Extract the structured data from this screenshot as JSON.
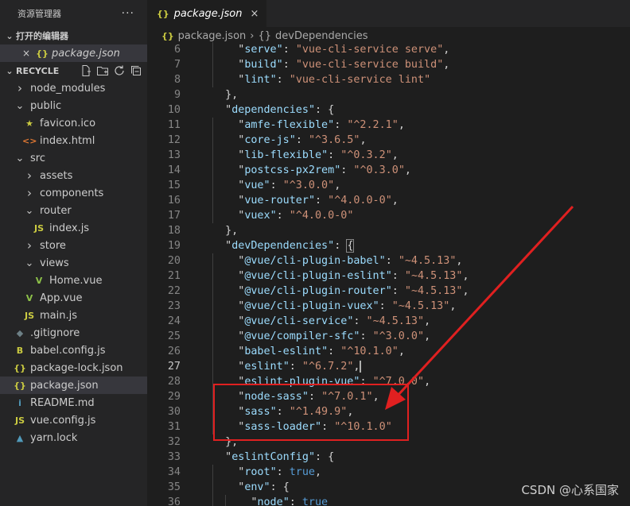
{
  "sidebar": {
    "title": "资源管理器",
    "more": "···",
    "open_editors_title": "打开的编辑器",
    "open_editor": {
      "close": "×",
      "icon": "{}",
      "name": "package.json"
    },
    "project_title": "RECYCLE",
    "tree": [
      {
        "label": "node_modules",
        "type": "folder",
        "expanded": false,
        "depth": 1
      },
      {
        "label": "public",
        "type": "folder",
        "expanded": true,
        "depth": 1
      },
      {
        "label": "favicon.ico",
        "type": "file",
        "icon": "★",
        "icon_color": "#cbcb41",
        "depth": 2
      },
      {
        "label": "index.html",
        "type": "file",
        "icon": "<>",
        "icon_color": "#e37933",
        "depth": 2
      },
      {
        "label": "src",
        "type": "folder",
        "expanded": true,
        "depth": 1
      },
      {
        "label": "assets",
        "type": "folder",
        "expanded": false,
        "depth": 2
      },
      {
        "label": "components",
        "type": "folder",
        "expanded": false,
        "depth": 2
      },
      {
        "label": "router",
        "type": "folder",
        "expanded": true,
        "depth": 2
      },
      {
        "label": "index.js",
        "type": "file",
        "icon": "JS",
        "icon_color": "#cbcb41",
        "depth": 3
      },
      {
        "label": "store",
        "type": "folder",
        "expanded": false,
        "depth": 2
      },
      {
        "label": "views",
        "type": "folder",
        "expanded": true,
        "depth": 2
      },
      {
        "label": "Home.vue",
        "type": "file",
        "icon": "V",
        "icon_color": "#8dc149",
        "depth": 3
      },
      {
        "label": "App.vue",
        "type": "file",
        "icon": "V",
        "icon_color": "#8dc149",
        "depth": 2
      },
      {
        "label": "main.js",
        "type": "file",
        "icon": "JS",
        "icon_color": "#cbcb41",
        "depth": 2
      },
      {
        "label": ".gitignore",
        "type": "file",
        "icon": "◆",
        "icon_color": "#6d8086",
        "depth": 1
      },
      {
        "label": "babel.config.js",
        "type": "file",
        "icon": "B",
        "icon_color": "#cbcb41",
        "depth": 1
      },
      {
        "label": "package-lock.json",
        "type": "file",
        "icon": "{}",
        "icon_color": "#cbcb41",
        "depth": 1
      },
      {
        "label": "package.json",
        "type": "file",
        "icon": "{}",
        "icon_color": "#cbcb41",
        "depth": 1,
        "selected": true
      },
      {
        "label": "README.md",
        "type": "file",
        "icon": "i",
        "icon_color": "#519aba",
        "depth": 1
      },
      {
        "label": "vue.config.js",
        "type": "file",
        "icon": "JS",
        "icon_color": "#cbcb41",
        "depth": 1
      },
      {
        "label": "yarn.lock",
        "type": "file",
        "icon": "▲",
        "icon_color": "#519aba",
        "depth": 1
      }
    ]
  },
  "editor": {
    "tab": {
      "icon": "{}",
      "label": "package.json",
      "close": "×"
    },
    "breadcrumb": {
      "file_icon": "{}",
      "file": "package.json",
      "separator": "›",
      "symbol_icon": "{}",
      "symbol": "devDependencies"
    },
    "current_line": 27,
    "lines": [
      {
        "n": 6,
        "indent": 2,
        "key": "serve",
        "value": "vue-cli-service serve",
        "comma": true
      },
      {
        "n": 7,
        "indent": 2,
        "key": "build",
        "value": "vue-cli-service build",
        "comma": true
      },
      {
        "n": 8,
        "indent": 2,
        "key": "lint",
        "value": "vue-cli-service lint",
        "comma": false
      },
      {
        "n": 9,
        "indent": 1,
        "raw": "},"
      },
      {
        "n": 10,
        "indent": 1,
        "key": "dependencies",
        "open": "{"
      },
      {
        "n": 11,
        "indent": 2,
        "key": "amfe-flexible",
        "value": "^2.2.1",
        "comma": true
      },
      {
        "n": 12,
        "indent": 2,
        "key": "core-js",
        "value": "^3.6.5",
        "comma": true
      },
      {
        "n": 13,
        "indent": 2,
        "key": "lib-flexible",
        "value": "^0.3.2",
        "comma": true
      },
      {
        "n": 14,
        "indent": 2,
        "key": "postcss-px2rem",
        "value": "^0.3.0",
        "comma": true
      },
      {
        "n": 15,
        "indent": 2,
        "key": "vue",
        "value": "^3.0.0",
        "comma": true
      },
      {
        "n": 16,
        "indent": 2,
        "key": "vue-router",
        "value": "^4.0.0-0",
        "comma": true
      },
      {
        "n": 17,
        "indent": 2,
        "key": "vuex",
        "value": "^4.0.0-0",
        "comma": false
      },
      {
        "n": 18,
        "indent": 1,
        "raw": "},"
      },
      {
        "n": 19,
        "indent": 1,
        "key": "devDependencies",
        "open": "{",
        "bracket_highlight": true
      },
      {
        "n": 20,
        "indent": 2,
        "key": "@vue/cli-plugin-babel",
        "value": "~4.5.13",
        "comma": true
      },
      {
        "n": 21,
        "indent": 2,
        "key": "@vue/cli-plugin-eslint",
        "value": "~4.5.13",
        "comma": true
      },
      {
        "n": 22,
        "indent": 2,
        "key": "@vue/cli-plugin-router",
        "value": "~4.5.13",
        "comma": true
      },
      {
        "n": 23,
        "indent": 2,
        "key": "@vue/cli-plugin-vuex",
        "value": "~4.5.13",
        "comma": true
      },
      {
        "n": 24,
        "indent": 2,
        "key": "@vue/cli-service",
        "value": "~4.5.13",
        "comma": true
      },
      {
        "n": 25,
        "indent": 2,
        "key": "@vue/compiler-sfc",
        "value": "^3.0.0",
        "comma": true
      },
      {
        "n": 26,
        "indent": 2,
        "key": "babel-eslint",
        "value": "^10.1.0",
        "comma": true
      },
      {
        "n": 27,
        "indent": 2,
        "key": "eslint",
        "value": "^6.7.2",
        "comma": true,
        "cursor": true
      },
      {
        "n": 28,
        "indent": 2,
        "key": "eslint-plugin-vue",
        "value": "^7.0.0",
        "comma": true
      },
      {
        "n": 29,
        "indent": 2,
        "key": "node-sass",
        "value": "^7.0.1",
        "comma": true
      },
      {
        "n": 30,
        "indent": 2,
        "key": "sass",
        "value": "^1.49.9",
        "comma": true
      },
      {
        "n": 31,
        "indent": 2,
        "key": "sass-loader",
        "value": "^10.1.0",
        "comma": false
      },
      {
        "n": 32,
        "indent": 1,
        "raw": "},"
      },
      {
        "n": 33,
        "indent": 1,
        "key": "eslintConfig",
        "open": "{"
      },
      {
        "n": 34,
        "indent": 2,
        "key": "root",
        "bool": "true",
        "comma": true
      },
      {
        "n": 35,
        "indent": 2,
        "key": "env",
        "open": "{"
      },
      {
        "n": 36,
        "indent": 3,
        "key": "node",
        "bool": "true",
        "comma": false
      }
    ]
  },
  "colors": {
    "background": "#1e1e1e",
    "sidebar": "#252526",
    "json_key": "#9cdcfe",
    "json_string": "#ce9178",
    "json_literal": "#569cd6",
    "annotation": "#e02020"
  },
  "watermark": "CSDN @心系国家"
}
